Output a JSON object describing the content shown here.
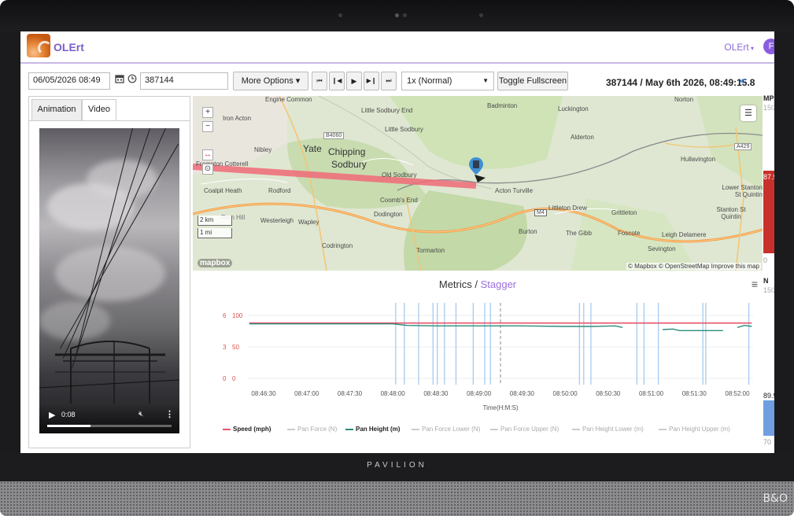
{
  "device": {
    "brand": "PAVILION",
    "speaker_logo": "B&O"
  },
  "app": {
    "title": "OLErt",
    "user_menu": "OLErt",
    "user_initial": "F"
  },
  "toolbar": {
    "datetime": "06/05/2026 08:49",
    "calendar_icon": "calendar-icon",
    "clock_icon": "clock-icon",
    "record_id": "387144",
    "more_options": "More Options",
    "transport": [
      "⏮",
      "❙◀",
      "▶",
      "▶❙",
      "⏭"
    ],
    "speed_select": "1x (Normal)",
    "fullscreen": "Toggle Fullscreen",
    "status": "387144 / May 6th 2026, 08:49:15.8",
    "share_icon": "<"
  },
  "left_panel": {
    "tabs": [
      {
        "label": "Animation",
        "active": false
      },
      {
        "label": "Video",
        "active": true
      }
    ],
    "video": {
      "time": "0:08",
      "progress": 0.35
    }
  },
  "map": {
    "labels": [
      {
        "text": "Engine Common"
      },
      {
        "text": "Iron Acton"
      },
      {
        "text": "Little Sodbury End"
      },
      {
        "text": "Little Sodbury"
      },
      {
        "text": "Badminton"
      },
      {
        "text": "Luckington"
      },
      {
        "text": "Alderton"
      },
      {
        "text": "Norton"
      },
      {
        "text": "Hullavington"
      },
      {
        "text": "Nibley"
      },
      {
        "text": "Yate"
      },
      {
        "text": "Chipping"
      },
      {
        "text": "Sodbury"
      },
      {
        "text": "Old Sodbury"
      },
      {
        "text": "Frampton Cotterell"
      },
      {
        "text": "Coalpit Heath"
      },
      {
        "text": "Rodford"
      },
      {
        "text": "Coomb's End"
      },
      {
        "text": "Acton Turville"
      },
      {
        "text": "Dodington"
      },
      {
        "text": "Littleton Drew"
      },
      {
        "text": "Grittleton"
      },
      {
        "text": "Lower Stanton St Quintin"
      },
      {
        "text": "Stanton St Quintin"
      },
      {
        "text": "Ram Hill"
      },
      {
        "text": "Westerleigh"
      },
      {
        "text": "Wapley"
      },
      {
        "text": "Burton"
      },
      {
        "text": "The Gibb"
      },
      {
        "text": "Foscote"
      },
      {
        "text": "Leigh Delamere"
      },
      {
        "text": "Codrington"
      },
      {
        "text": "Tormarton"
      },
      {
        "text": "Sevington"
      }
    ],
    "road_badges": [
      "B4060",
      "A429",
      "M4"
    ],
    "scale": [
      "2 km",
      "1 mi"
    ],
    "zoom_in": "+",
    "zoom_out": "−",
    "attribution": "© Mapbox © OpenStreetMap Improve this map",
    "mapbox_logo": "mapbox",
    "colors": {
      "track": "#f06a78",
      "marker": "#2d3e50"
    }
  },
  "chart": {
    "title_main": "Metrics",
    "title_sep": " / ",
    "title_accent": "Stagger",
    "menu_icon": "hamburger-icon",
    "legend": [
      {
        "label": "Speed (mph)",
        "color": "#e8546b",
        "active": true
      },
      {
        "label": "Pan Force (N)",
        "color": "#cccccc",
        "active": false
      },
      {
        "label": "Pan Height (m)",
        "color": "#2b8c7c",
        "active": true
      },
      {
        "label": "Pan Force Lower (N)",
        "color": "#cccccc",
        "active": false
      },
      {
        "label": "Pan Force Upper (N)",
        "color": "#cccccc",
        "active": false
      },
      {
        "label": "Pan Height Lower (m)",
        "color": "#cccccc",
        "active": false
      },
      {
        "label": "Pan Height Upper (m)",
        "color": "#cccccc",
        "active": false
      }
    ]
  },
  "chart_data": {
    "type": "line",
    "title": "Metrics / Stagger",
    "xlabel": "Time(H:M:S)",
    "x_ticks": [
      "08:46:30",
      "08:47:00",
      "08:47:30",
      "08:48:00",
      "08:48:30",
      "08:49:00",
      "08:49:30",
      "08:50:00",
      "08:50:30",
      "08:51:00",
      "08:51:30",
      "08:52:00"
    ],
    "y_left_ticks": [
      "6",
      "3",
      "0"
    ],
    "y_right_ticks": [
      "100",
      "50",
      "0"
    ],
    "xlim_seconds": [
      0,
      360
    ],
    "cursor_time": "08:49:15",
    "series": [
      {
        "name": "Speed (mph)",
        "color": "#e8546b",
        "axis": "speed",
        "x": [
          "08:46:20",
          "08:52:10"
        ],
        "y": [
          87.9,
          87.9
        ]
      },
      {
        "name": "Pan Height (m)",
        "color": "#2b8c7c",
        "axis": "height",
        "x": [
          "08:46:20",
          "08:47:30",
          "08:48:00",
          "08:48:10",
          "08:48:30",
          "08:49:00",
          "08:49:30",
          "08:50:00",
          "08:50:20",
          "08:50:35",
          "08:50:40"
        ],
        "y": [
          5.2,
          5.2,
          5.2,
          5.05,
          5.0,
          5.0,
          5.0,
          4.95,
          4.95,
          5.0,
          4.85
        ]
      },
      {
        "name": "Pan Height (m) segment 2",
        "color": "#2b8c7c",
        "axis": "height",
        "x": [
          "08:51:08",
          "08:51:15",
          "08:51:20",
          "08:51:50"
        ],
        "y": [
          4.65,
          4.7,
          4.55,
          4.55
        ]
      },
      {
        "name": "Pan Height (m) segment 3",
        "color": "#2b8c7c",
        "axis": "height",
        "x": [
          "08:52:00",
          "08:52:05",
          "08:52:10"
        ],
        "y": [
          4.85,
          5.05,
          4.95
        ]
      }
    ],
    "events": [
      "08:48:02",
      "08:48:08",
      "08:48:18",
      "08:48:28",
      "08:48:31",
      "08:48:36",
      "08:48:44",
      "08:48:56",
      "08:49:04",
      "08:49:08",
      "08:50:10",
      "08:50:13",
      "08:50:18",
      "08:50:50",
      "08:50:55",
      "08:51:05",
      "08:51:36",
      "08:51:38",
      "08:52:08"
    ],
    "grid": true
  },
  "gauges": {
    "speed": {
      "label": "MPH",
      "max": "150",
      "value": "87.9",
      "min": "0",
      "value_num": 87.9,
      "max_num": 150,
      "color": "#c9302c"
    },
    "force": {
      "label": "N",
      "max": "150",
      "value": "89.9",
      "min": "70",
      "value_num": 89.9,
      "max_num": 150,
      "min_num": 70,
      "color": "#6f9fe0"
    }
  }
}
